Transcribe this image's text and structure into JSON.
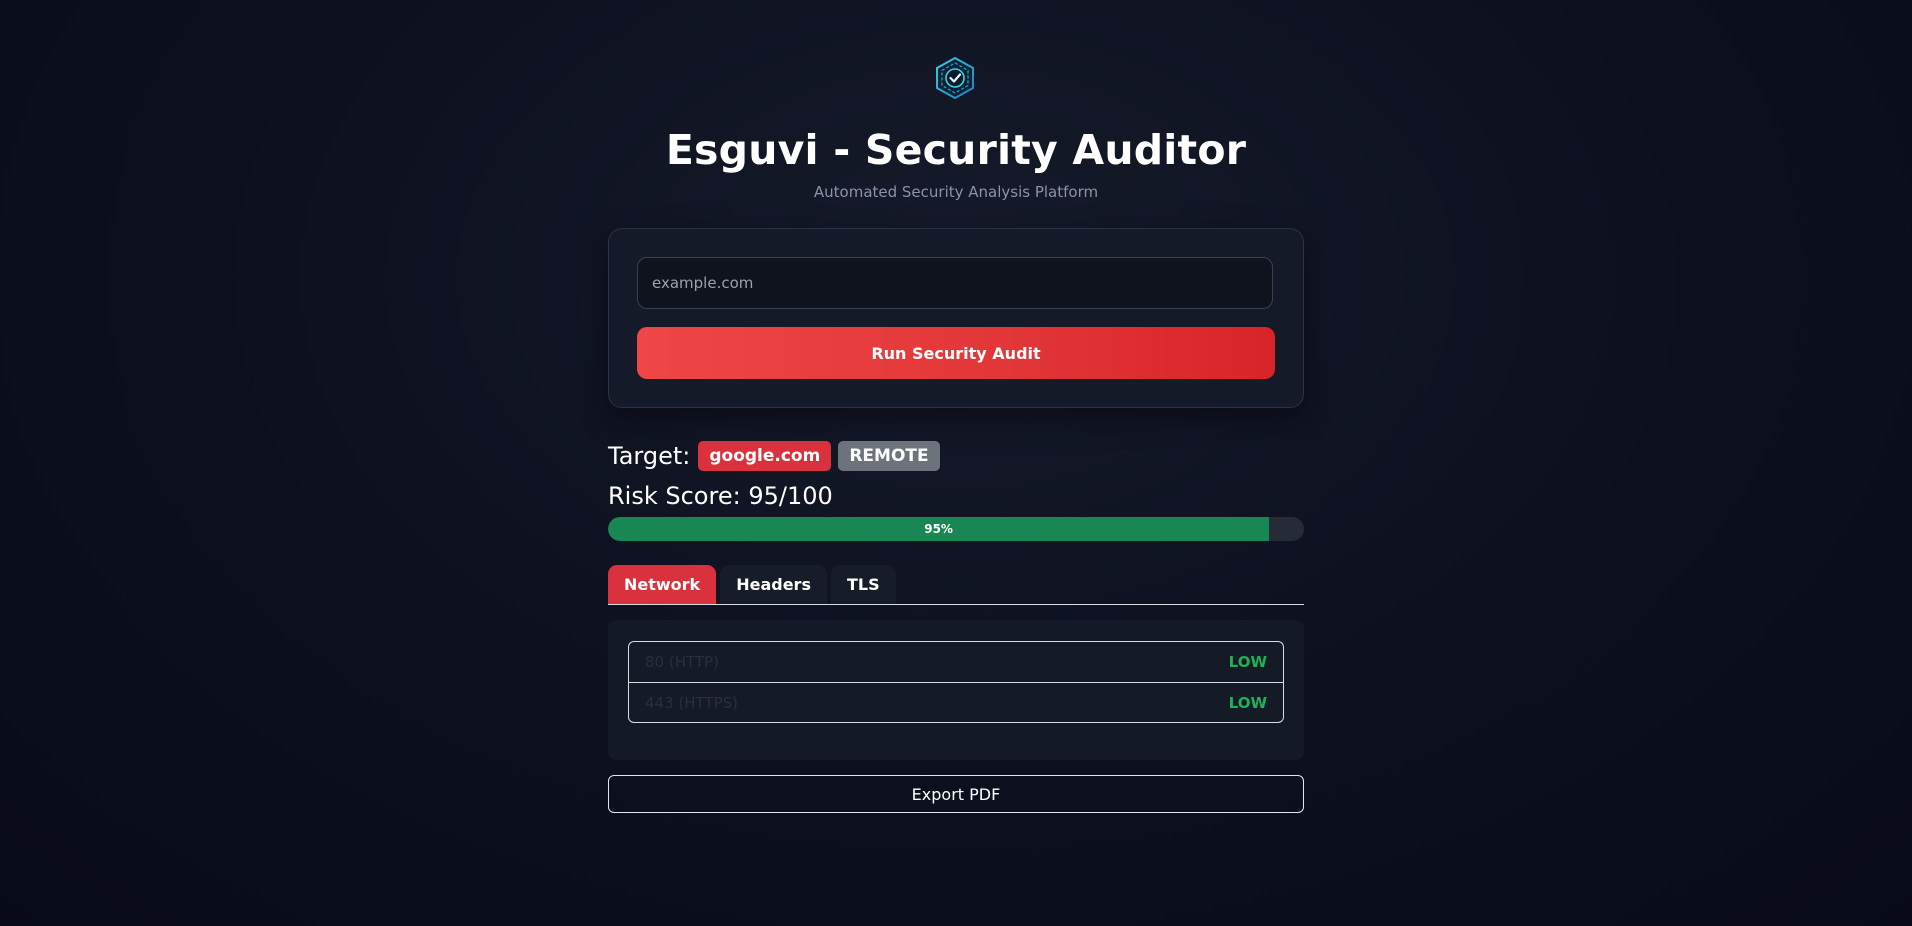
{
  "header": {
    "logo_icon": "shield-check-icon",
    "title": "Esguvi - Security Auditor",
    "subtitle": "Automated Security Analysis Platform"
  },
  "form": {
    "input_placeholder": "example.com",
    "input_value": "",
    "run_label": "Run Security Audit"
  },
  "result": {
    "target_label": "Target:",
    "target": "google.com",
    "mode_badge": "REMOTE",
    "risk_label": "Risk Score:",
    "risk_value": "95/100",
    "progress_fraction": 0.95,
    "progress_text": "95%"
  },
  "tabs": [
    {
      "label": "Network",
      "active": true
    },
    {
      "label": "Headers",
      "active": false
    },
    {
      "label": "TLS",
      "active": false
    }
  ],
  "network": {
    "rows": [
      {
        "port": "80 (HTTP)",
        "level": "LOW"
      },
      {
        "port": "443 (HTTPS)",
        "level": "LOW"
      }
    ]
  },
  "actions": {
    "export_label": "Export PDF"
  },
  "colors": {
    "accent": "#d9323e",
    "success": "#198754",
    "low": "#1fb155"
  }
}
